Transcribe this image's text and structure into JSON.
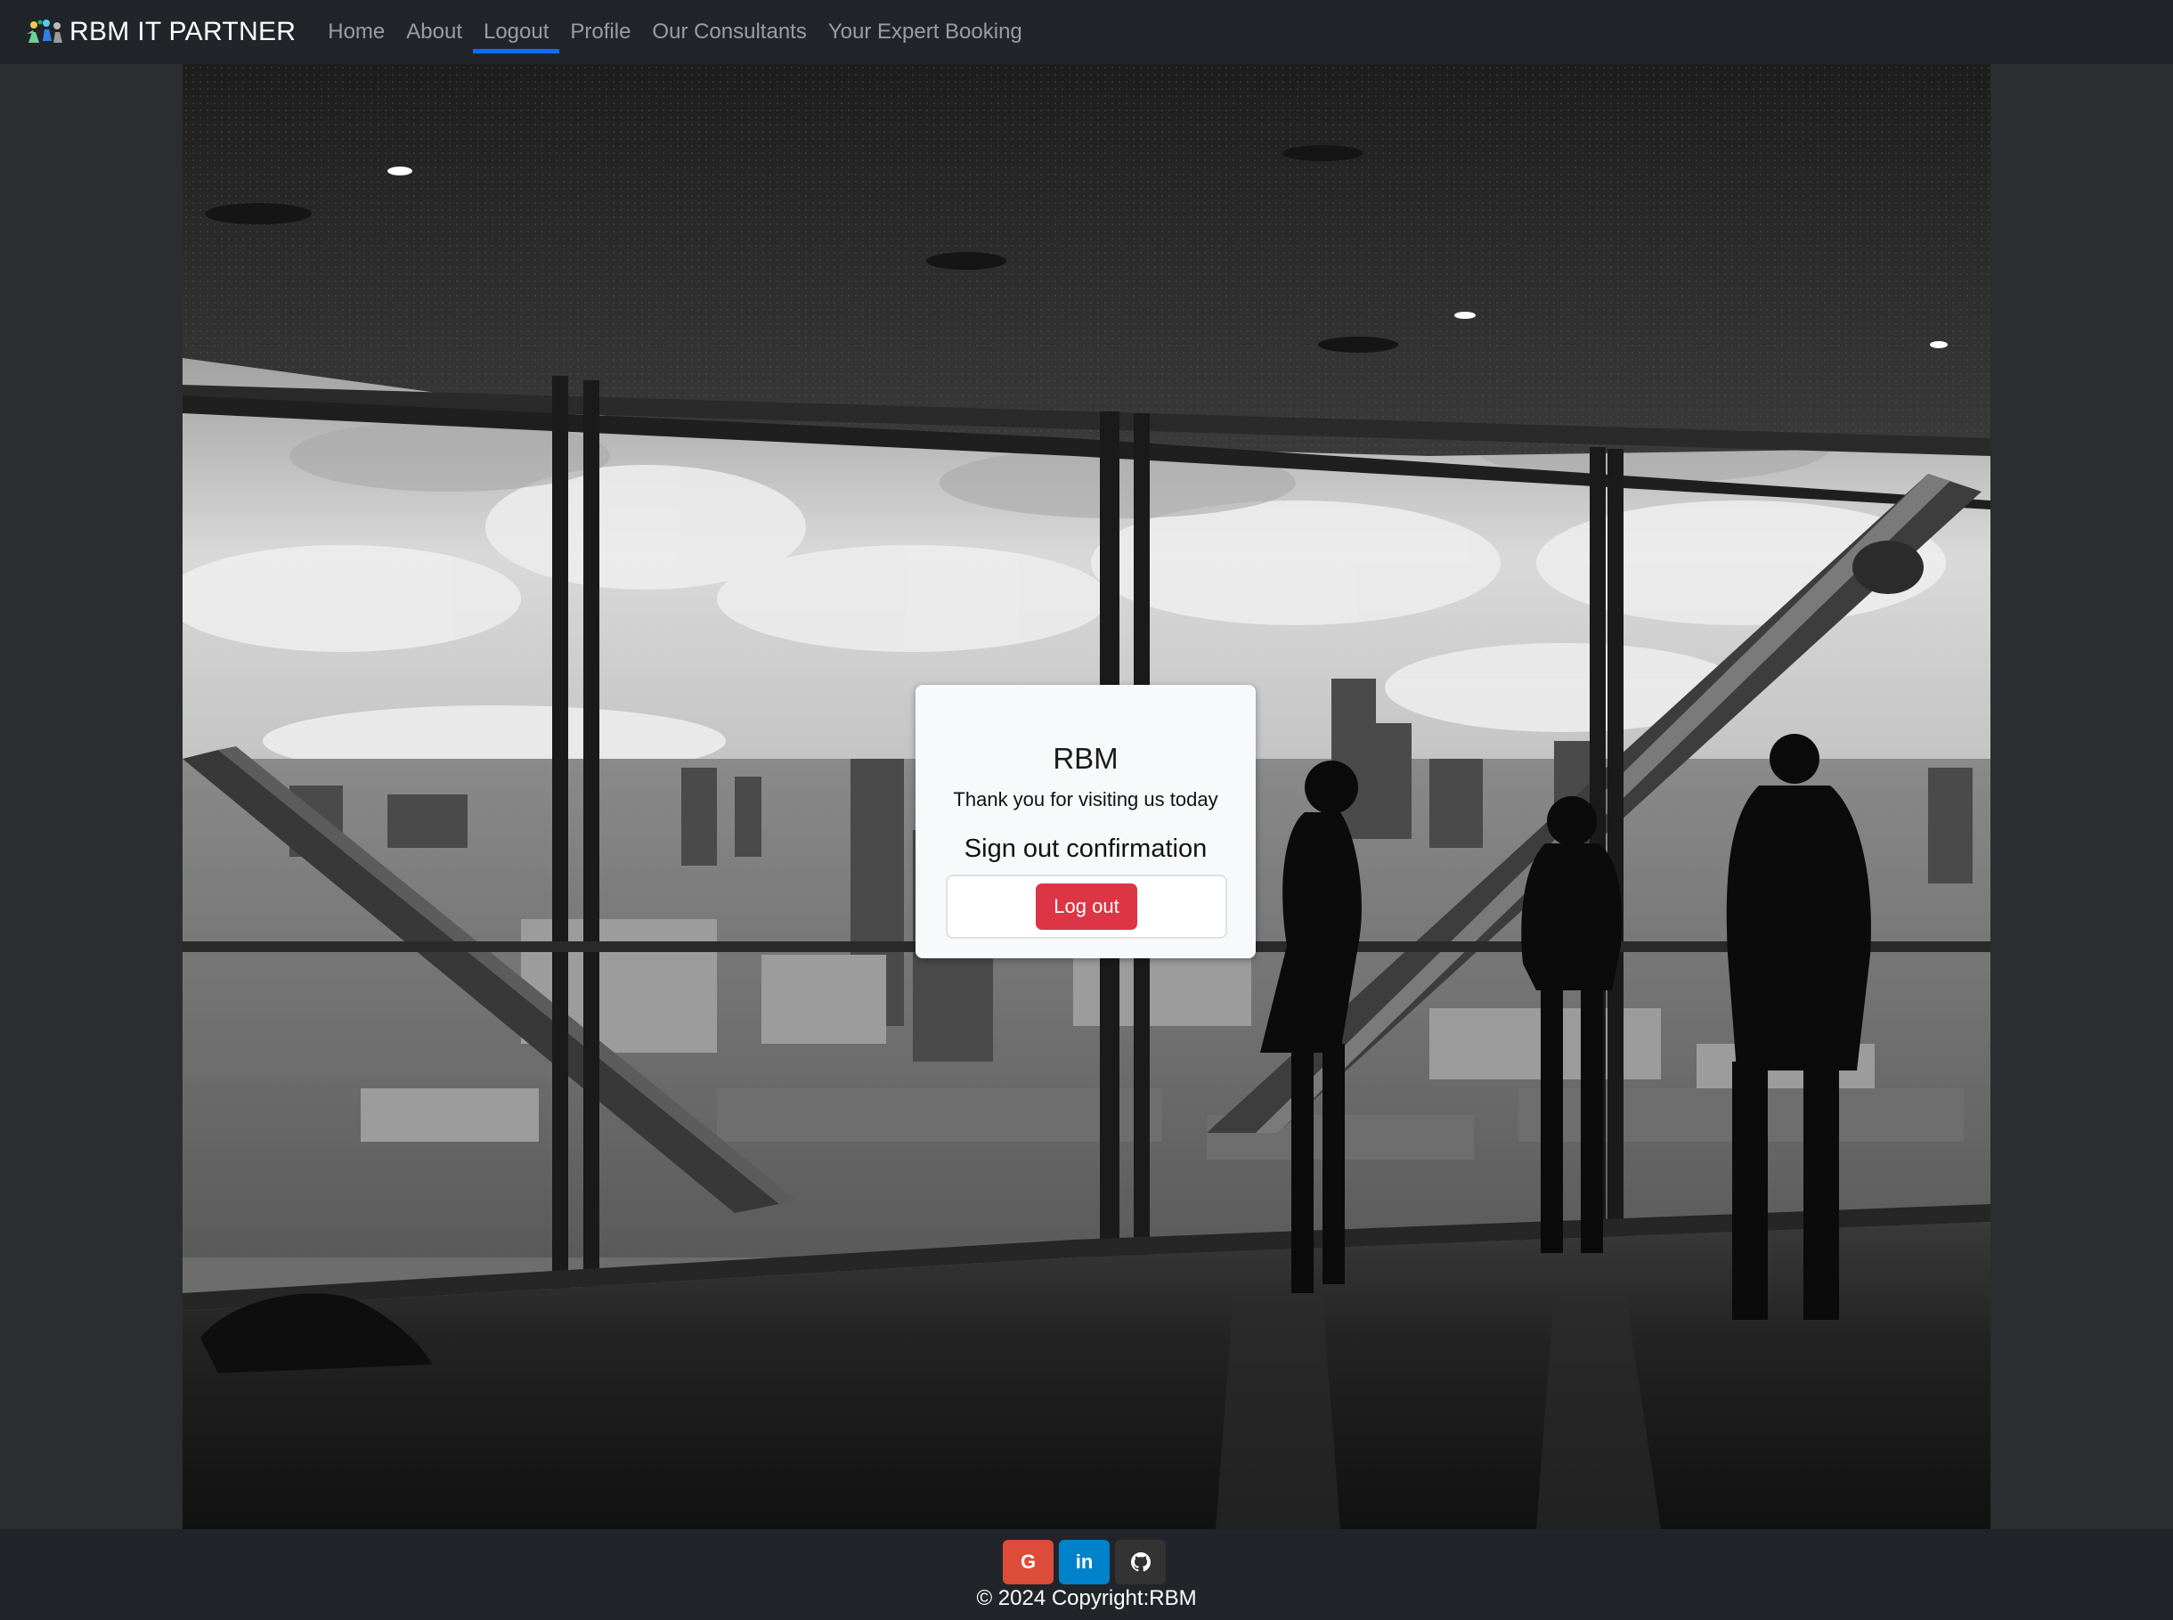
{
  "navbar": {
    "brand": "RBM IT PARTNER",
    "links": [
      {
        "label": "Home",
        "active": false
      },
      {
        "label": "About",
        "active": false
      },
      {
        "label": "Logout",
        "active": true
      },
      {
        "label": "Profile",
        "active": false
      },
      {
        "label": "Our Consultants",
        "active": false
      },
      {
        "label": "Your Expert Booking",
        "active": false
      }
    ]
  },
  "logout_card": {
    "title": "RBM",
    "subtitle": "Thank you for visiting us today",
    "heading": "Sign out confirmation",
    "button_label": "Log out",
    "button_color": "#dc3545"
  },
  "footer": {
    "social": [
      {
        "icon": "google-icon",
        "glyph": "G",
        "color": "#dd4b39"
      },
      {
        "icon": "linkedin-icon",
        "glyph": "in",
        "color": "#0082ca"
      },
      {
        "icon": "github-icon",
        "glyph": "",
        "color": "#333333"
      }
    ],
    "copyright": "© 2024 Copyright:RBM"
  },
  "colors": {
    "navbar_bg": "#212529",
    "nav_active_underline": "#0d6efd",
    "page_bg": "#2b2d31"
  }
}
